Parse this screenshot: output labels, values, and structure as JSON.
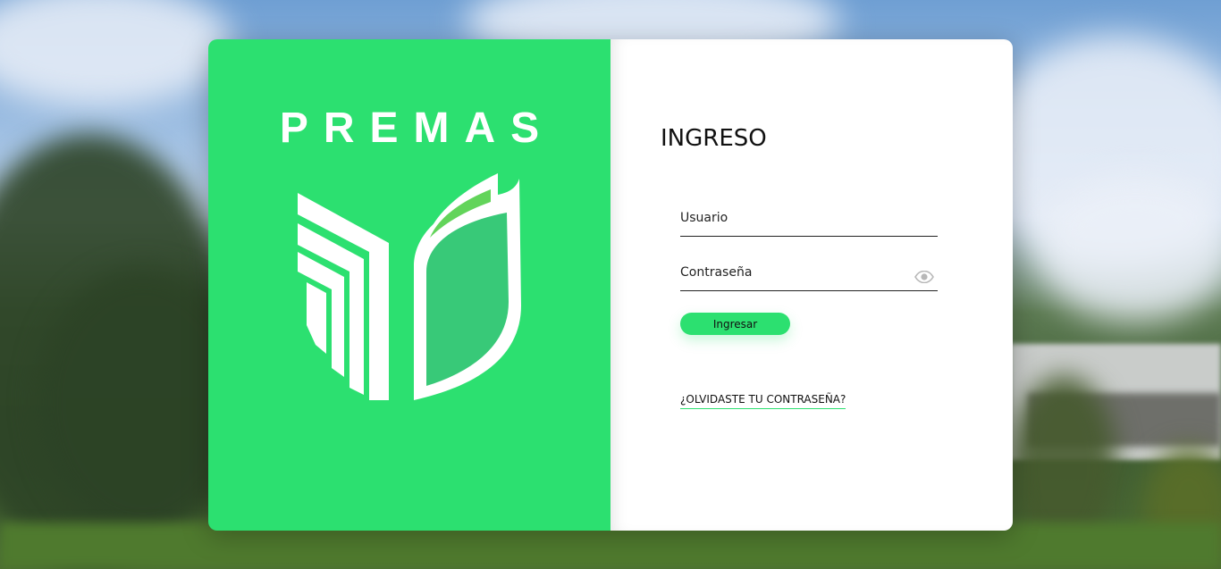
{
  "brand": {
    "name": "PREMAS",
    "color": "#2ce070"
  },
  "login": {
    "title": "INGRESO",
    "username_placeholder": "Usuario",
    "username_value": "",
    "password_placeholder": "Contraseña",
    "password_value": "",
    "password_toggle_icon": "eye-icon",
    "submit_label": "Ingresar",
    "forgot_label": "¿OLVIDASTE TU CONTRASEÑA?"
  }
}
